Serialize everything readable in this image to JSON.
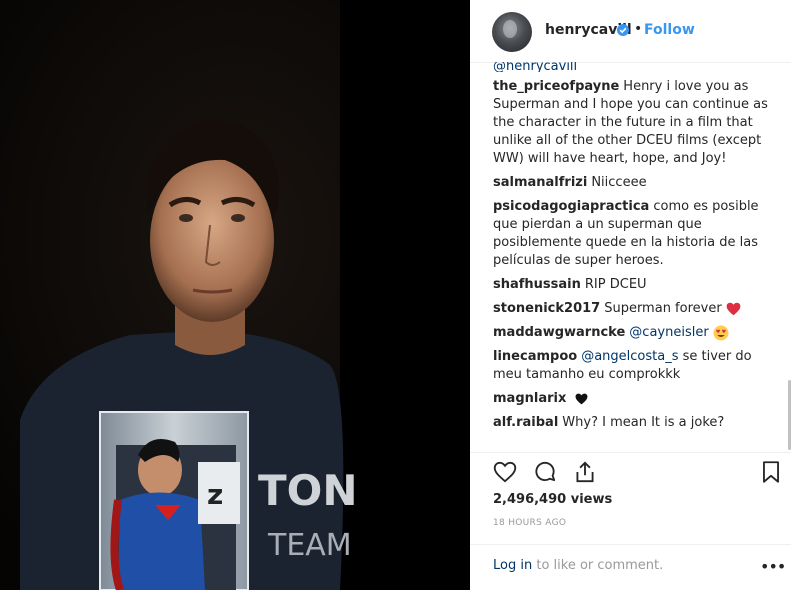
{
  "header": {
    "username": "henrycavill",
    "separator": "•",
    "follow_label": "Follow"
  },
  "comments": {
    "cut_off_text": "@henrycavill",
    "items": [
      {
        "user": "the_priceofpayne",
        "text": "Henry i love you as Superman and I hope you can continue as the character in the future in a film that unlike all of the other DCEU films (except WW) will have heart, hope, and Joy!"
      },
      {
        "user": "salmanalfrizi",
        "text": "Niicceee"
      },
      {
        "user": "psicodagogiapractica",
        "text": "como es posible que pierdan a un superman que posiblemente quede en la historia de las películas de super heroes."
      },
      {
        "user": "shafhussain",
        "text": "RIP DCEU"
      },
      {
        "user": "stonenick2017",
        "text": "Superman forever",
        "emoji": "red-heart-icon"
      },
      {
        "user": "maddawgwarncke",
        "mention": "@cayneisler",
        "emoji": "heart-eyes-icon"
      },
      {
        "user": "linecampoo",
        "mention": "@angelcosta_s",
        "text": "se tiver do meu tamanho eu comprokkk"
      },
      {
        "user": "magnlarix",
        "emoji": "black-heart-icon"
      },
      {
        "user": "alf.raibal",
        "text": "Why? I mean It is a joke?"
      }
    ]
  },
  "actions": {
    "icons": [
      "heart-icon",
      "comment-icon",
      "share-icon",
      "bookmark-icon"
    ]
  },
  "stats": {
    "views": "2,496,490 views",
    "time": "18 HOURS AGO"
  },
  "footer": {
    "login_link": "Log in",
    "login_suffix": "to like or comment.",
    "more": "•••"
  },
  "media": {
    "figure_box_letter": "z",
    "shirt_text_1": "TON",
    "shirt_text_2": "TEAM"
  },
  "colors": {
    "link_blue": "#3897f0",
    "mention_navy": "#003569",
    "text": "#262626",
    "muted": "#999999",
    "heart_red": "#ed4956"
  }
}
